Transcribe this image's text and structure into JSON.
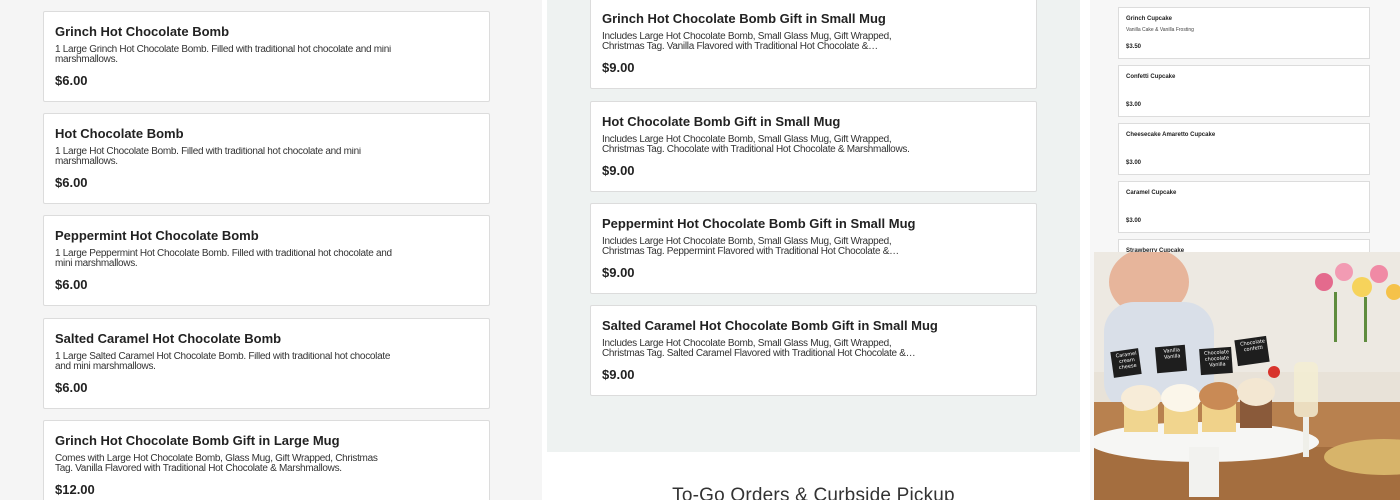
{
  "left_column": {
    "items": [
      {
        "name": "Grinch Hot Chocolate Bomb",
        "description": "1 Large Grinch Hot Chocolate Bomb. Filled with traditional hot chocolate and mini marshmallows.",
        "price": "$6.00"
      },
      {
        "name": "Hot Chocolate Bomb",
        "description": "1 Large Hot Chocolate Bomb. Filled with traditional hot chocolate and mini marshmallows.",
        "price": "$6.00"
      },
      {
        "name": "Peppermint Hot Chocolate Bomb",
        "description": "1 Large Peppermint Hot Chocolate Bomb. Filled with traditional hot chocolate and mini marshmallows.",
        "price": "$6.00"
      },
      {
        "name": "Salted Caramel Hot Chocolate Bomb",
        "description": "1 Large Salted Caramel Hot Chocolate Bomb. Filled with traditional hot chocolate and mini marshmallows.",
        "price": "$6.00"
      },
      {
        "name": "Grinch Hot Chocolate Bomb Gift in Large Mug",
        "description": "Comes with Large Hot Chocolate Bomb, Glass Mug, Gift Wrapped, Christmas Tag. Vanilla Flavored with Traditional Hot Chocolate & Marshmallows.",
        "price": "$12.00"
      }
    ]
  },
  "middle_column": {
    "items": [
      {
        "name": "Grinch Hot Chocolate Bomb Gift in Small Mug",
        "description": "Includes Large Hot Chocolate Bomb, Small Glass Mug, Gift Wrapped, Christmas Tag. Vanilla Flavored with Traditional Hot Chocolate &…",
        "price": "$9.00"
      },
      {
        "name": "Hot Chocolate Bomb Gift in Small Mug",
        "description": "Includes Large Hot Chocolate Bomb, Small Glass Mug, Gift Wrapped, Christmas Tag. Chocolate with Traditional Hot Chocolate & Marshmallows.",
        "price": "$9.00"
      },
      {
        "name": "Peppermint Hot Chocolate Bomb Gift in Small Mug",
        "description": "Includes Large Hot Chocolate Bomb, Small Glass Mug, Gift Wrapped, Christmas Tag. Peppermint Flavored with Traditional Hot Chocolate &…",
        "price": "$9.00"
      },
      {
        "name": "Salted Caramel Hot Chocolate Bomb Gift in Small Mug",
        "description": "Includes Large Hot Chocolate Bomb, Small Glass Mug, Gift Wrapped, Christmas Tag. Salted Caramel Flavored with Traditional Hot Chocolate &…",
        "price": "$9.00"
      }
    ],
    "pickup_title": "To-Go Orders & Curbside Pickup"
  },
  "right_column": {
    "items": [
      {
        "name": "Grinch Cupcake",
        "description": "Vanilla Cake & Vanilla Frosting",
        "price": "$3.50"
      },
      {
        "name": "Confetti Cupcake",
        "description": "",
        "price": "$3.00"
      },
      {
        "name": "Cheesecake Amaretto Cupcake",
        "description": "",
        "price": "$3.00"
      },
      {
        "name": "Caramel Cupcake",
        "description": "",
        "price": "$3.00"
      },
      {
        "name": "Strawberry Cupcake",
        "description": "",
        "price": ""
      }
    ],
    "photo_signs": [
      "Caramel cream cheese",
      "Vanilla Vanilla",
      "Chocolate chocolate Vanilla",
      "Chocolate confetti"
    ]
  },
  "colors": {
    "card_border": "#dcdcdc",
    "left_bg": "#f5f5f5",
    "middle_bg": "#eef2f1",
    "text": "#222222"
  }
}
